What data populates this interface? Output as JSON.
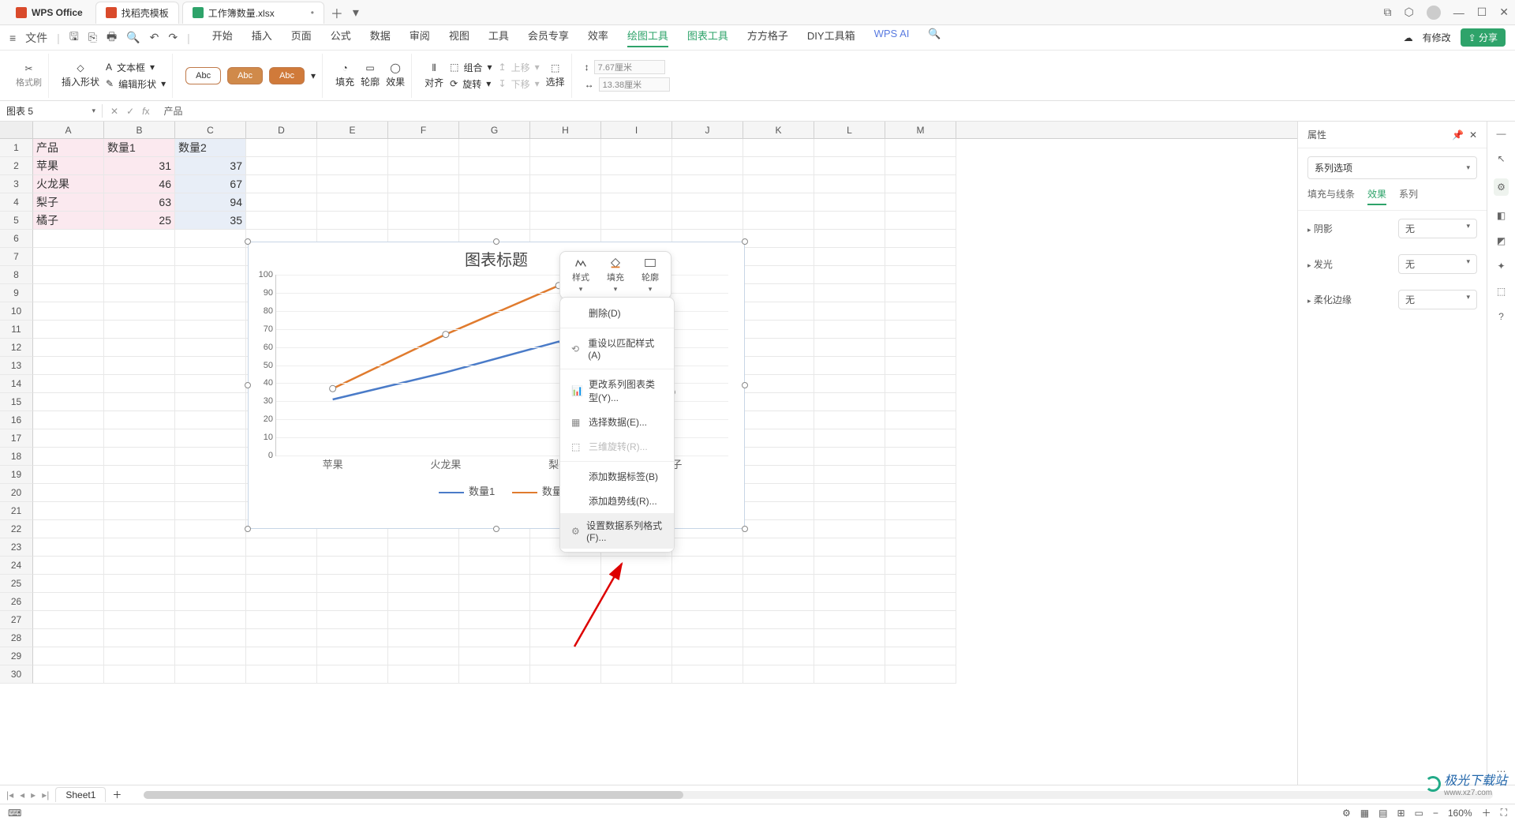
{
  "title_tabs": {
    "app": "WPS Office",
    "tab1": "找稻壳模板",
    "tab2": "工作簿数量.xlsx"
  },
  "window_controls": {
    "cube": "⬚",
    "hex": "⬡",
    "min": "—",
    "max": "☐",
    "close": "✕"
  },
  "file_menu": "文件",
  "menu": {
    "start": "开始",
    "insert": "插入",
    "page": "页面",
    "formula": "公式",
    "data": "数据",
    "review": "审阅",
    "view": "视图",
    "tool": "工具",
    "member": "会员专享",
    "efficiency": "效率",
    "drawtool": "绘图工具",
    "charttool": "图表工具",
    "square": "方方格子",
    "diy": "DIY工具箱",
    "wpsai": "WPS AI"
  },
  "top_right": {
    "modify": "有修改",
    "share": "分享"
  },
  "ribbon": {
    "format_brush": "格式刷",
    "insert_shape": "插入形状",
    "textbox": "文本框",
    "edit_shape": "编辑形状",
    "abc": "Abc",
    "fill": "填充",
    "outline": "轮廓",
    "effect": "效果",
    "align": "对齐",
    "group": "组合",
    "rotate": "旋转",
    "moveup": "上移",
    "movedown": "下移",
    "select": "选择",
    "dim_w": "7.67厘米",
    "dim_h": "13.38厘米"
  },
  "namebox": "图表 5",
  "formula_text": "产品",
  "cols": [
    "A",
    "B",
    "C",
    "D",
    "E",
    "F",
    "G",
    "H",
    "I",
    "J",
    "K",
    "L",
    "M"
  ],
  "rows_count": 30,
  "cells": {
    "A1": "产品",
    "B1": "数量1",
    "C1": "数量2",
    "A2": "苹果",
    "B2": "31",
    "C2": "37",
    "A3": "火龙果",
    "B3": "46",
    "C3": "67",
    "A4": "梨子",
    "B4": "63",
    "C4": "94",
    "A5": "橘子",
    "B5": "25",
    "C5": "35"
  },
  "mini_toolbar": {
    "style": "样式",
    "fill": "填充",
    "outline": "轮廓"
  },
  "context_menu": {
    "delete": "删除(D)",
    "reset": "重设以匹配样式(A)",
    "change_type": "更改系列图表类型(Y)...",
    "select_data": "选择数据(E)...",
    "rotate3d": "三维旋转(R)...",
    "add_label": "添加数据标签(B)",
    "add_trend": "添加趋势线(R)...",
    "format_series": "设置数据系列格式(F)..."
  },
  "right_panel": {
    "title": "属性",
    "series_opt": "系列选项",
    "tab_fill": "填充与线条",
    "tab_effect": "效果",
    "tab_series": "系列",
    "shadow": "阴影",
    "glow": "发光",
    "softedge": "柔化边缘",
    "none": "无"
  },
  "sheet_tab": "Sheet1",
  "status": {
    "zoom": "160%"
  },
  "watermark": {
    "name": "极光下载站",
    "url": "www.xz7.com"
  },
  "chart_data": {
    "type": "line",
    "title": "图表标题",
    "categories": [
      "苹果",
      "火龙果",
      "梨子",
      "橘子"
    ],
    "series": [
      {
        "name": "数量1",
        "values": [
          31,
          46,
          63,
          25
        ],
        "color": "#4a7bc8"
      },
      {
        "name": "数量2",
        "values": [
          37,
          67,
          94,
          35
        ],
        "color": "#e07b2e"
      }
    ],
    "ylim": [
      0,
      100
    ],
    "yticks": [
      0,
      10,
      20,
      30,
      40,
      50,
      60,
      70,
      80,
      90,
      100
    ],
    "xlabel": "",
    "ylabel": ""
  }
}
